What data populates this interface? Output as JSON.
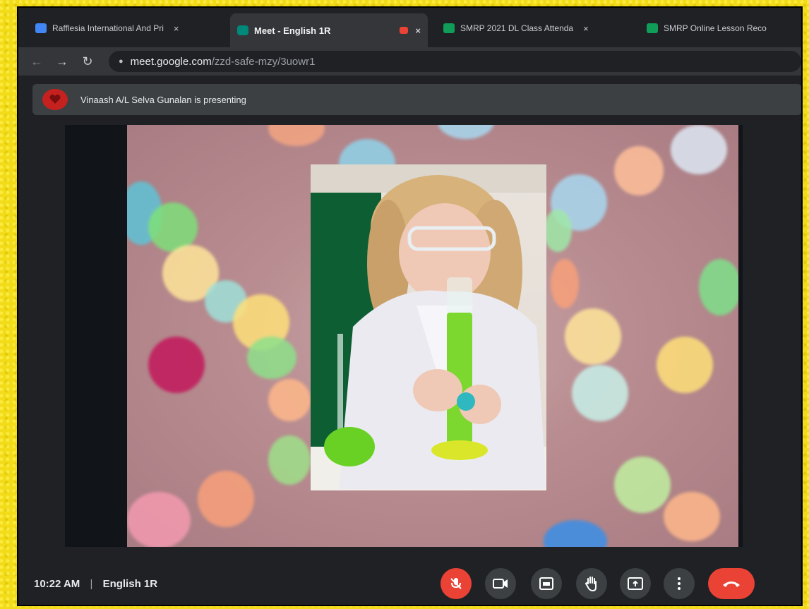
{
  "browser": {
    "tabs": [
      {
        "label": "Rafflesia International And Pri",
        "favicon_color": "#4285f4"
      },
      {
        "label": "Meet - English 1R",
        "favicon_color": "#00897b"
      },
      {
        "label": "SMRP 2021 DL Class Attenda",
        "favicon_color": "#0f9d58"
      },
      {
        "label": "SMRP Online Lesson Reco",
        "favicon_color": "#0f9d58"
      }
    ],
    "tab_close": "×",
    "url_host": "meet.google.com",
    "url_path": "/zzd-safe-mzy/3uowr1"
  },
  "presenting_banner": "Vinaash A/L Selva Gunalan is presenting",
  "call": {
    "time": "10:22 AM",
    "separator": "|",
    "meeting_name": "English 1R"
  },
  "controls": [
    {
      "name": "microphone-off",
      "icon": "mic-off-icon"
    },
    {
      "name": "camera",
      "icon": "camera-icon"
    },
    {
      "name": "captions",
      "icon": "captions-icon"
    },
    {
      "name": "raise-hand",
      "icon": "hand-icon"
    },
    {
      "name": "present-now",
      "icon": "present-icon"
    },
    {
      "name": "more-options",
      "icon": "more-vert-icon"
    },
    {
      "name": "leave-call",
      "icon": "phone-hangup-icon"
    }
  ],
  "colors": {
    "accent_red": "#ea4335",
    "meet_bg": "#202124"
  }
}
